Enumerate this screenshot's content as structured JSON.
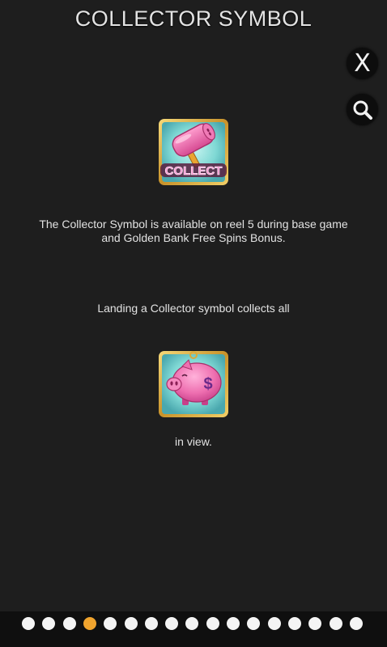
{
  "header": {
    "title": "COLLECTOR SYMBOL"
  },
  "controls": {
    "close_label": "X",
    "close_icon": "close-icon",
    "search_icon": "magnifier-icon"
  },
  "symbols": {
    "collector": {
      "icon": "hammer-collect-symbol",
      "label": "COLLECT"
    },
    "piggy": {
      "icon": "piggy-bank-symbol",
      "label": "$"
    }
  },
  "content": {
    "paragraph1": "The Collector Symbol is available on reel 5 during base game and Golden Bank Free Spins Bonus.",
    "paragraph2": "Landing a Collector symbol collects all",
    "paragraph3": "in view."
  },
  "pagination": {
    "total": 17,
    "active_index": 3,
    "colors": {
      "active": "#f0a42e",
      "inactive": "#f4f4f4"
    }
  },
  "colors": {
    "background": "#1e1e1e",
    "footer": "#0f0f0f",
    "frame_gold": "#d9a93a",
    "tile_teal": "#6ccfcf",
    "pig_pink": "#ec6fae"
  }
}
